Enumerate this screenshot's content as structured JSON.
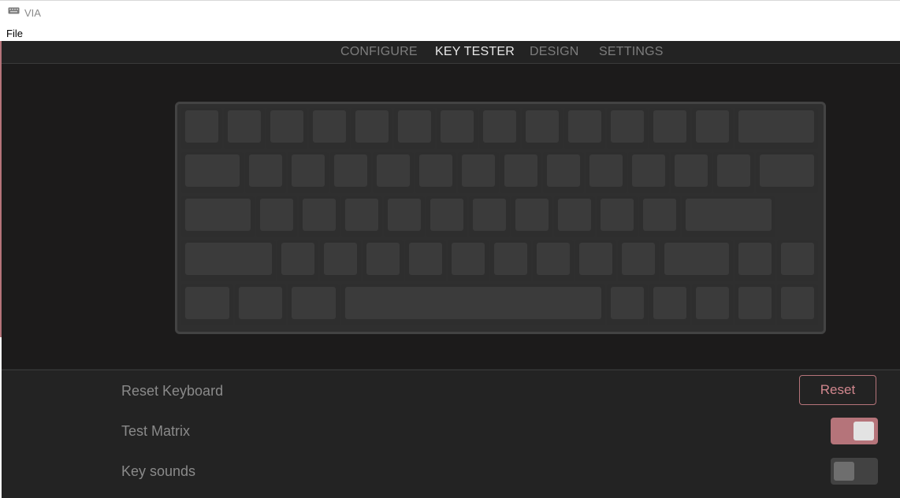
{
  "window": {
    "title": "VIA",
    "icon": "keyboard-icon"
  },
  "menu": {
    "file": "File"
  },
  "nav": {
    "tabs": [
      {
        "label": "CONFIGURE",
        "active": false
      },
      {
        "label": "KEY TESTER",
        "active": true
      },
      {
        "label": "DESIGN",
        "active": false
      },
      {
        "label": "SETTINGS",
        "active": false
      }
    ]
  },
  "keyboard": {
    "layout": "60% ANSI",
    "rows": [
      [
        1,
        1,
        1,
        1,
        1,
        1,
        1,
        1,
        1,
        1,
        1,
        1,
        1,
        2
      ],
      [
        1.5,
        1,
        1,
        1,
        1,
        1,
        1,
        1,
        1,
        1,
        1,
        1,
        1,
        1.5
      ],
      [
        1.75,
        1,
        1,
        1,
        1,
        1,
        1,
        1,
        1,
        1,
        1,
        2.25
      ],
      [
        2.25,
        1,
        1,
        1,
        1,
        1,
        1,
        1,
        1,
        1,
        1.75,
        1,
        1
      ],
      [
        1.25,
        1.25,
        1.25,
        6.25,
        1,
        1,
        1,
        1,
        1
      ]
    ]
  },
  "settings": {
    "reset_keyboard_label": "Reset Keyboard",
    "reset_button": "Reset",
    "test_matrix_label": "Test Matrix",
    "test_matrix_on": true,
    "key_sounds_label": "Key sounds",
    "key_sounds_on": false
  },
  "colors": {
    "accent": "#b5747a",
    "background": "#232323",
    "keycap": "#3b3b3b"
  }
}
